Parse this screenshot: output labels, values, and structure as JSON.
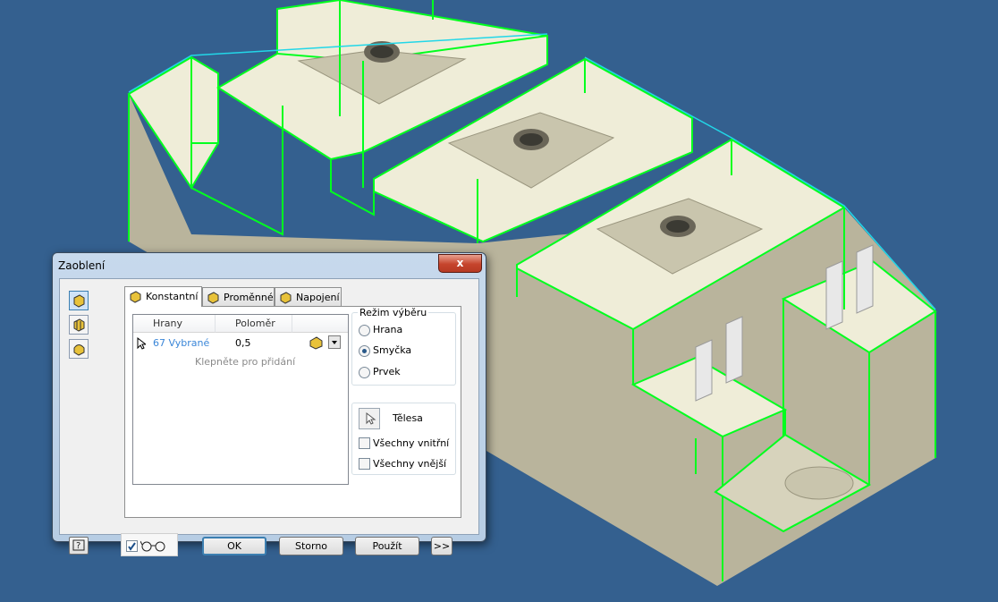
{
  "viewport": {
    "background": "#34608f",
    "model_face_color": "#efedd8",
    "model_side_color": "#b9b49c",
    "selection_color": "#00ff1e",
    "outline_color": "#22d7e8"
  },
  "dialog": {
    "title": "Zaoblení",
    "close_glyph": "x",
    "left_icons": [
      "fillet-edge-icon",
      "fillet-face-icon",
      "fillet-full-round-icon"
    ],
    "tabs": [
      {
        "label": "Konstantní",
        "icon": "constant-fillet-icon",
        "active": true
      },
      {
        "label": "Proměnné",
        "icon": "variable-fillet-icon",
        "active": false
      },
      {
        "label": "Napojení",
        "icon": "setback-icon",
        "active": false
      }
    ],
    "grid": {
      "columns": [
        "Hrany",
        "Poloměr"
      ],
      "rows": [
        {
          "edges": "67 Vybrané",
          "radius": "0,5"
        }
      ],
      "add_hint": "Klepněte pro přidání"
    },
    "selection_mode": {
      "legend": "Režim výběru",
      "options": [
        {
          "label": "Hrana",
          "checked": false
        },
        {
          "label": "Smyčka",
          "checked": true
        },
        {
          "label": "Prvek",
          "checked": false
        }
      ]
    },
    "bodies": {
      "label": "Tělesa",
      "all_inner": {
        "label": "Všechny vnitřní",
        "checked": false
      },
      "all_outer": {
        "label": "Všechny vnější",
        "checked": false
      }
    },
    "preview_checked": true,
    "buttons": {
      "ok": "OK",
      "cancel": "Storno",
      "apply": "Použít",
      "more": ">>"
    }
  }
}
